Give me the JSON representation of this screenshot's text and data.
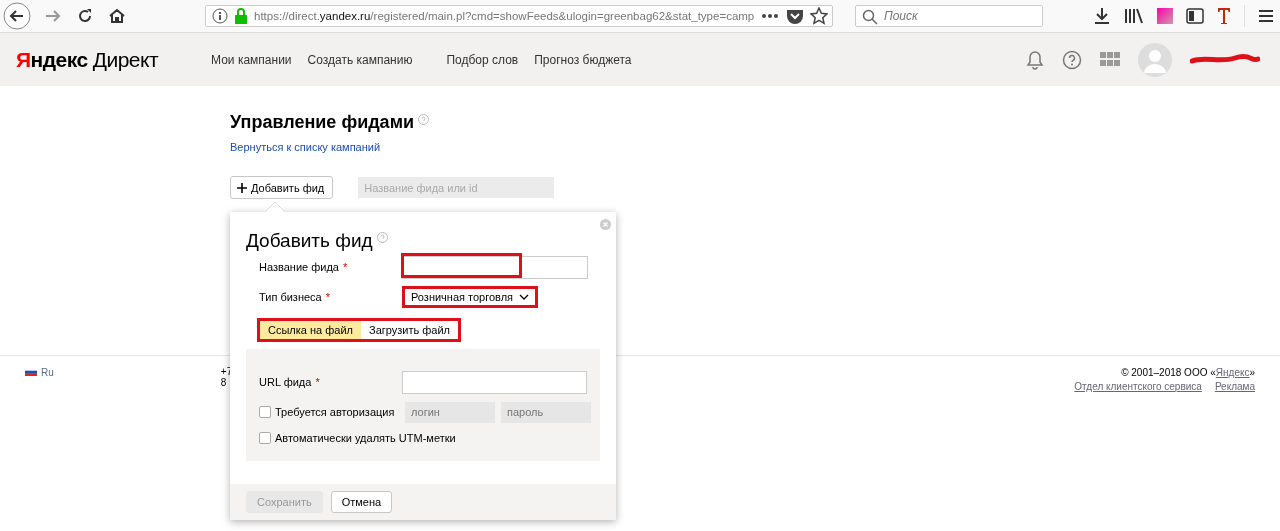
{
  "browser": {
    "url_host": "https://direct.",
    "url_domain": "yandex.ru",
    "url_path": "/registered/main.pl?cmd=showFeeds&ulogin=greenbag62&stat_type=camp",
    "search_placeholder": "Поиск"
  },
  "header": {
    "logo_red": "Я",
    "logo_rest": "ндекс",
    "logo_product": "Директ",
    "nav": [
      {
        "label": "Мои кампании"
      },
      {
        "label": "Создать кампанию"
      },
      {
        "label": "Подбор слов"
      },
      {
        "label": "Прогноз бюджета"
      }
    ],
    "user_redacted": true
  },
  "page": {
    "title": "Управление фидами",
    "back_link": "Вернуться к списку кампаний",
    "add_button": "Добавить фид",
    "filter_placeholder": "Название фида или id"
  },
  "dialog": {
    "title": "Добавить фид",
    "required_mark": "*",
    "name_label": "Название фида",
    "name_highlighted": true,
    "business_label": "Тип бизнеса",
    "business_value": "Розничная торговля",
    "business_highlighted": true,
    "tabs": [
      {
        "label": "Ссылка на файл",
        "selected": true
      },
      {
        "label": "Загрузить файл",
        "selected": false
      }
    ],
    "tabs_highlighted": true,
    "url_label": "URL фида",
    "auth_label": "Требуется авторизация",
    "auth_checked": false,
    "login_placeholder": "логин",
    "password_placeholder": "пароль",
    "utm_label": "Автоматически удалять UTM-метки",
    "utm_checked": false,
    "save_button": "Сохранить",
    "save_disabled": true,
    "cancel_button": "Отмена"
  },
  "footer": {
    "lang": "Ru",
    "phone_1": "+7",
    "phone_2": "8",
    "copyright": "© 2001–2018 ООО «",
    "copyright_link": "Яндекс",
    "copyright_end": "»",
    "links": [
      "Отдел клиентского сервиса",
      "Реклама"
    ]
  }
}
